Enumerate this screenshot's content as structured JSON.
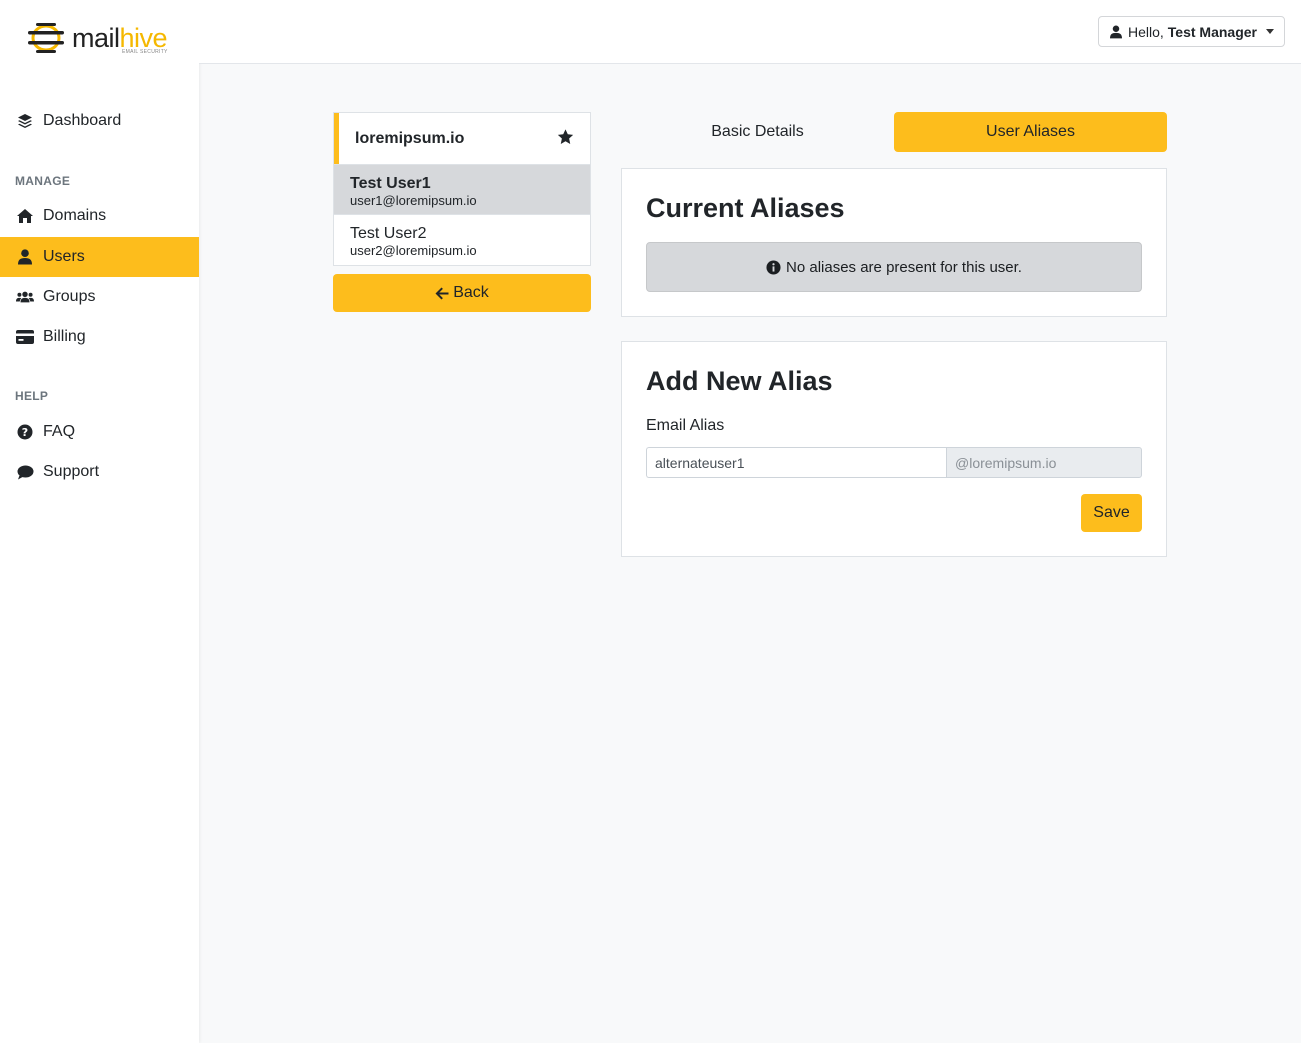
{
  "brand": {
    "name_part1": "mail",
    "name_part2": "hive",
    "tagline": "EMAIL SECURITY",
    "accent": "#fdbd1c"
  },
  "sidebar": {
    "dashboard": "Dashboard",
    "manage_heading": "MANAGE",
    "domains": "Domains",
    "users": "Users",
    "groups": "Groups",
    "billing": "Billing",
    "help_heading": "HELP",
    "faq": "FAQ",
    "support": "Support",
    "active_item": "Users"
  },
  "header": {
    "greeting": "Hello,",
    "user_name": "Test Manager"
  },
  "domain_panel": {
    "domain": "loremipsum.io",
    "users": [
      {
        "name": "Test User1",
        "email": "user1@loremipsum.io",
        "selected": true
      },
      {
        "name": "Test User2",
        "email": "user2@loremipsum.io",
        "selected": false
      }
    ],
    "back_label": "Back"
  },
  "tabs": {
    "basic": "Basic Details",
    "aliases": "User Aliases",
    "active": "User Aliases"
  },
  "current_aliases": {
    "title": "Current Aliases",
    "empty_message": "No aliases are present for this user."
  },
  "add_alias": {
    "title": "Add New Alias",
    "field_label": "Email Alias",
    "value": "alternateuser1",
    "domain_suffix": "@loremipsum.io",
    "save_label": "Save"
  }
}
